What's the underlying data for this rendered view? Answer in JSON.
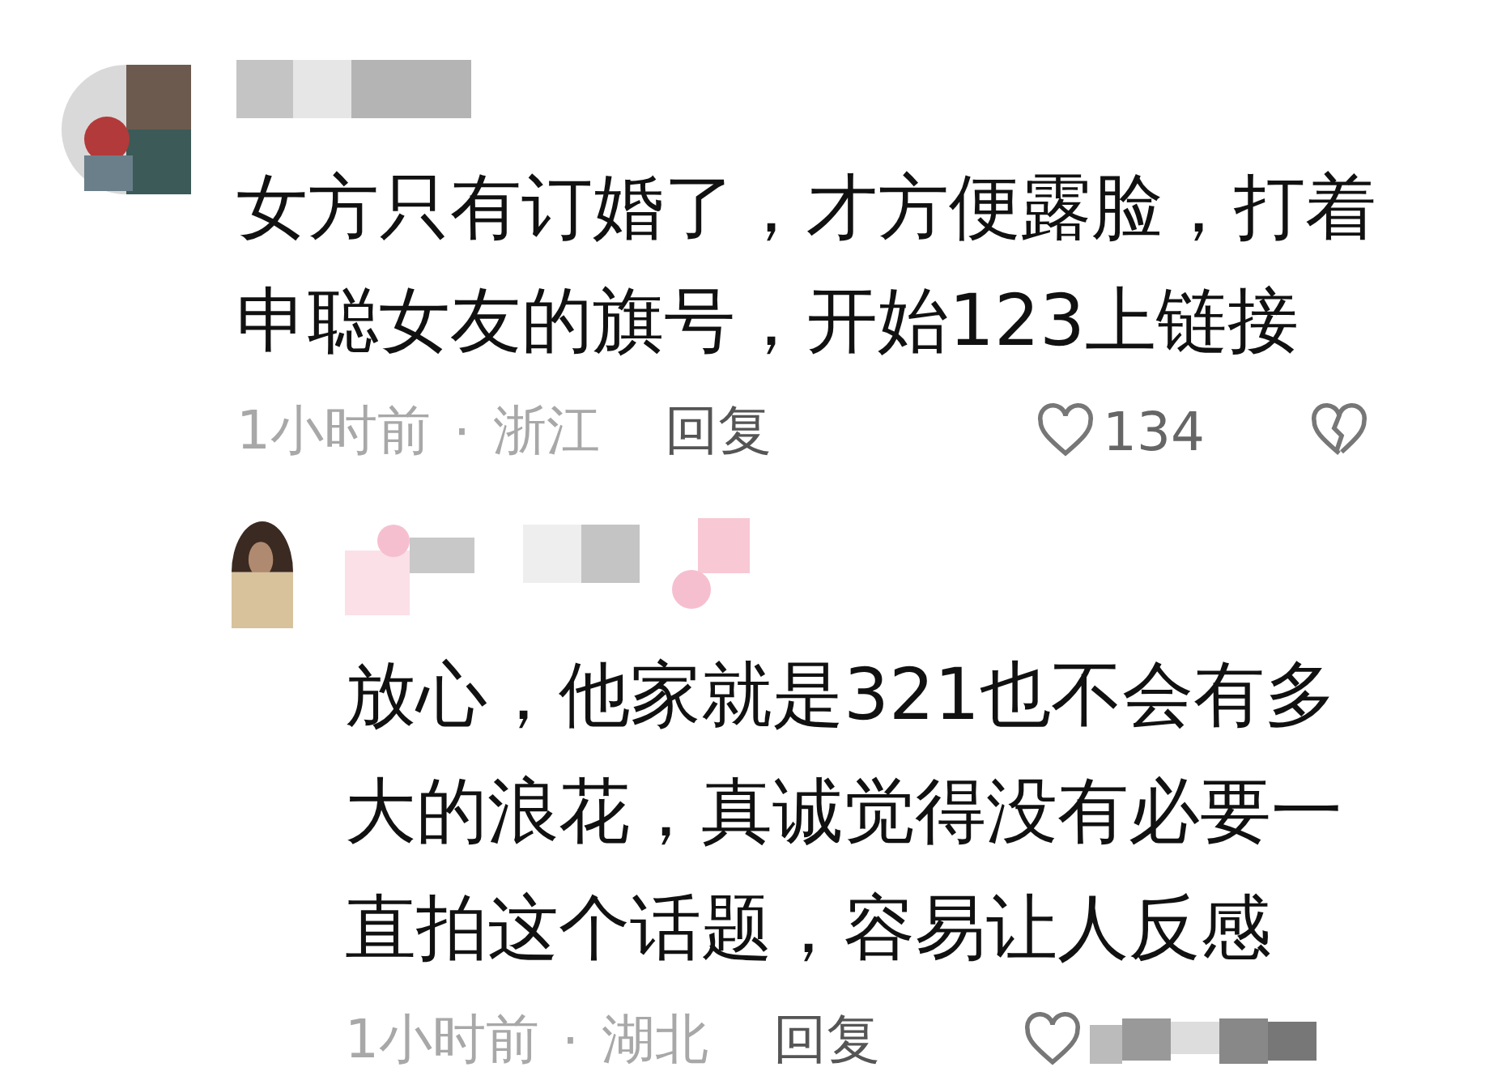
{
  "comments": [
    {
      "text": "女方只有订婚了，才方便露脸，打着申聪女友的旗号，开始123上链接",
      "time": "1小时前",
      "separator": "·",
      "location": "浙江",
      "reply_label": "回复",
      "likes": "134",
      "is_reply": false
    },
    {
      "text": "放心，他家就是321也不会有多大的浪花，真诚觉得没有必要一直拍这个话题，容易让人反感",
      "time": "1小时前",
      "separator": "·",
      "location": "湖北",
      "reply_label": "回复",
      "is_reply": true
    }
  ]
}
